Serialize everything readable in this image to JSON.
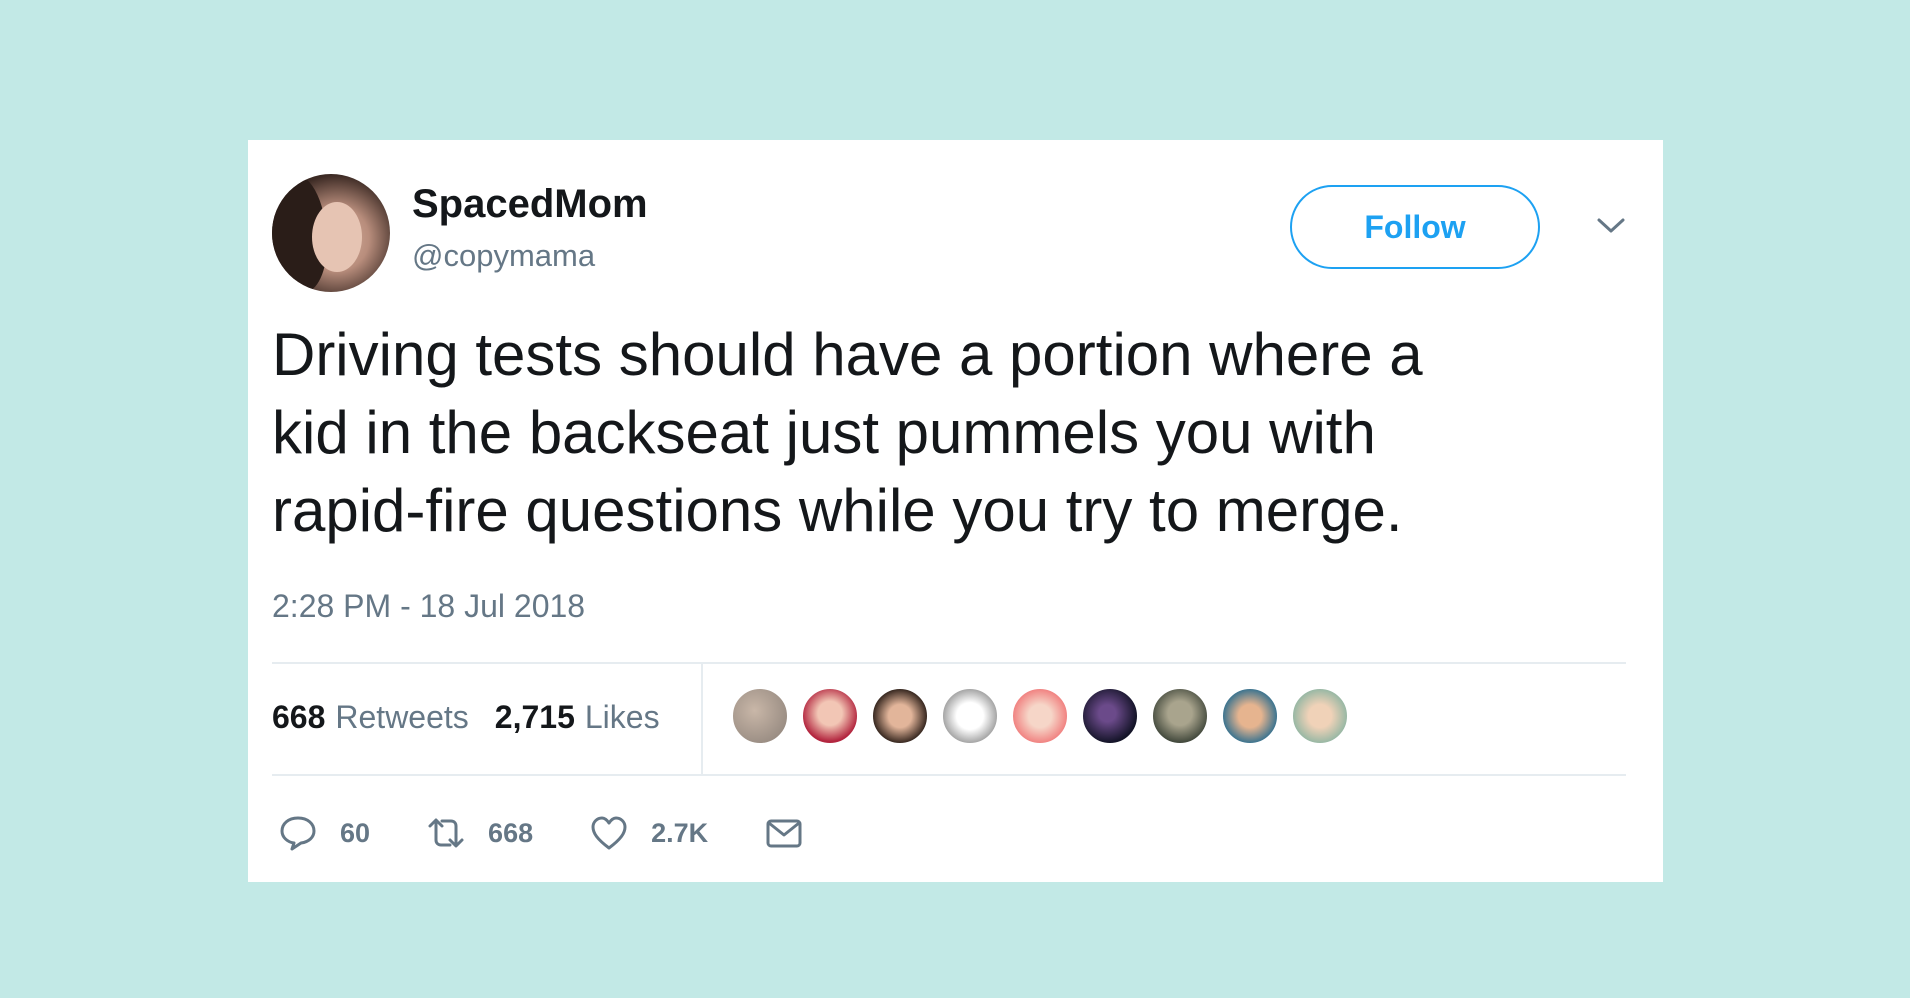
{
  "tweet": {
    "author_name": "SpacedMom",
    "author_handle": "@copymama",
    "follow_label": "Follow",
    "text": "Driving tests should have a portion where a\nkid in the backseat just pummels you with\nrapid-fire questions while you try to merge.",
    "timestamp": "2:28 PM - 18 Jul 2018"
  },
  "stats": {
    "retweets_count": "668",
    "retweets_label": "Retweets",
    "likes_count": "2,715",
    "likes_label": "Likes"
  },
  "actions": {
    "reply_count": "60",
    "retweet_count": "668",
    "like_count": "2.7K"
  },
  "icons": {
    "reply": "reply-icon",
    "retweet": "retweet-icon",
    "like": "heart-icon",
    "message": "envelope-icon",
    "menu": "chevron-down-icon"
  },
  "colors": {
    "background": "#c2e9e6",
    "card": "#ffffff",
    "accent": "#1da1f2",
    "text": "#14171a",
    "muted": "#657786"
  }
}
